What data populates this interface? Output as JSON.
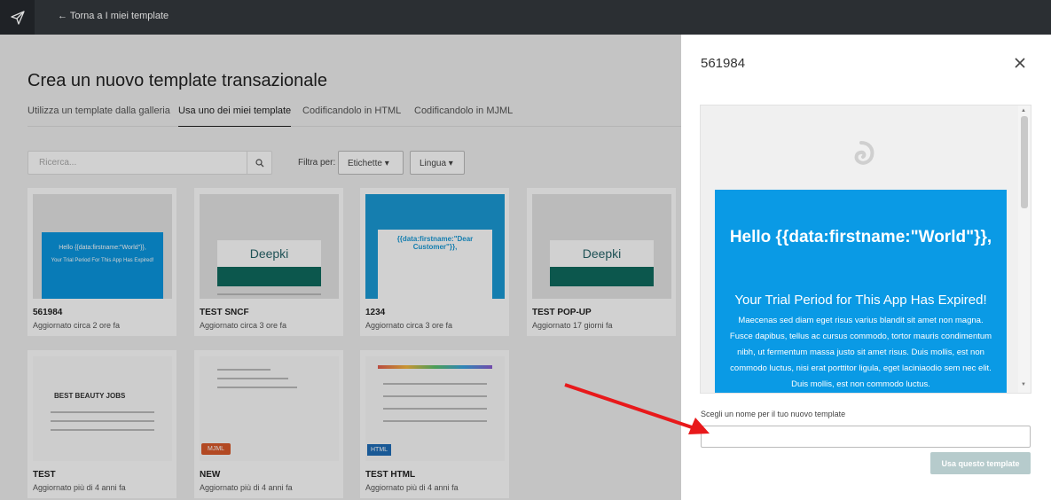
{
  "topbar": {
    "back_label": "← Torna a I miei template",
    "logo_icon": "paper-plane-icon"
  },
  "page": {
    "title": "Crea un nuovo template transazionale",
    "tabs": [
      {
        "label": "Utilizza un template dalla galleria"
      },
      {
        "label": "Usa uno dei miei template",
        "active": true
      },
      {
        "label": "Codificandolo in HTML"
      },
      {
        "label": "Codificandolo in MJML"
      }
    ],
    "search": {
      "placeholder": "Ricerca..."
    },
    "filter_label": "Filtra per:",
    "filters": [
      {
        "label": "Etichette ▾"
      },
      {
        "label": "Lingua ▾"
      }
    ]
  },
  "templates": [
    {
      "name": "561984",
      "updated": "Aggiornato circa 2 ore fa"
    },
    {
      "name": "TEST SNCF",
      "updated": "Aggiornato circa 3 ore fa",
      "thumb_brand": "Deepki"
    },
    {
      "name": "1234",
      "updated": "Aggiornato circa 3 ore fa",
      "thumb_heading": "{{data:firstname:\"Dear Customer\"}},"
    },
    {
      "name": "TEST POP-UP",
      "updated": "Aggiornato 17 giorni fa",
      "thumb_brand": "Deepki"
    },
    {
      "name": "TEST",
      "updated": "Aggiornato più di 4 anni fa",
      "thumb_brand": "BEST BEAUTY JOBS"
    },
    {
      "name": "NEW",
      "updated": "Aggiornato più di 4 anni fa",
      "tag": "MJML"
    },
    {
      "name": "TEST HTML",
      "updated": "Aggiornato più di 4 anni fa",
      "tag": "HTML"
    }
  ],
  "panel": {
    "title": "561984",
    "preview": {
      "heading": "Hello {{data:firstname:\"World\"}},",
      "subheading": "Your Trial Period for This App Has Expired!",
      "body": "Maecenas sed diam eget risus varius blandit sit amet non magna. Fusce dapibus, tellus ac cursus commodo, tortor mauris condimentum nibh, ut fermentum massa justo sit amet risus. Duis mollis, est non commodo luctus, nisi erat porttitor ligula, eget laciniaodio sem nec elit. Duis mollis, est non commodo luctus."
    },
    "name_label": "Scegli un nome per il tuo nuovo template",
    "name_value": "",
    "use_button": "Usa questo template"
  },
  "colors": {
    "accent": "#0a9ae5",
    "button_disabled": "#b6cbcc",
    "annotation_arrow": "#e8191b"
  }
}
